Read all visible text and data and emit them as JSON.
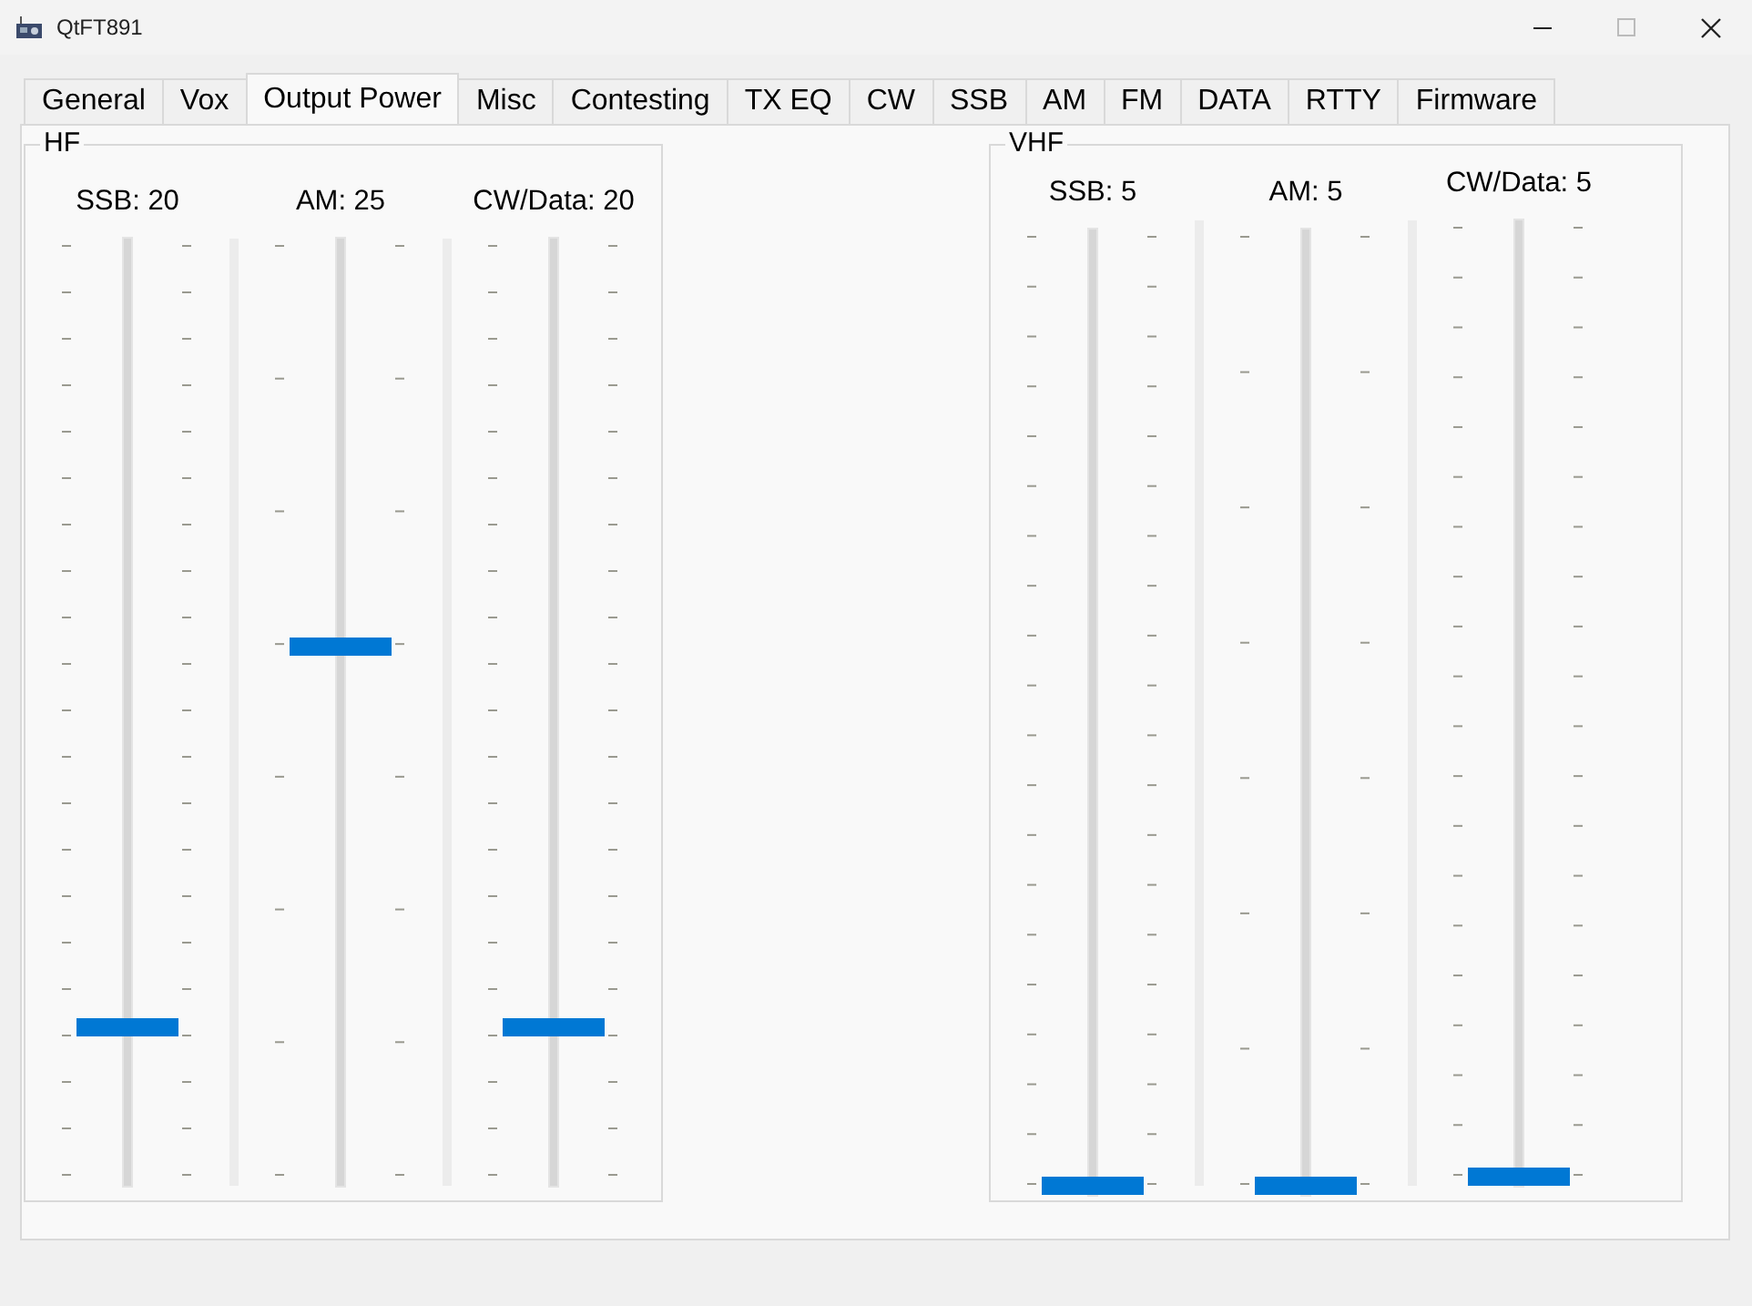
{
  "window": {
    "title": "QtFT891"
  },
  "tabs": [
    {
      "label": "General",
      "selected": false
    },
    {
      "label": "Vox",
      "selected": false
    },
    {
      "label": "Output Power",
      "selected": true
    },
    {
      "label": "Misc",
      "selected": false
    },
    {
      "label": "Contesting",
      "selected": false
    },
    {
      "label": "TX EQ",
      "selected": false
    },
    {
      "label": "CW",
      "selected": false
    },
    {
      "label": "SSB",
      "selected": false
    },
    {
      "label": "AM",
      "selected": false
    },
    {
      "label": "FM",
      "selected": false
    },
    {
      "label": "DATA",
      "selected": false
    },
    {
      "label": "RTTY",
      "selected": false
    },
    {
      "label": "Firmware",
      "selected": false
    }
  ],
  "groups": [
    {
      "title": "HF",
      "sliders": [
        {
          "label": "SSB: 20",
          "level": 0.16
        },
        {
          "label": "AM: 25",
          "level": 0.57
        },
        {
          "label": "CW/Data: 20",
          "level": 0.16
        }
      ]
    },
    {
      "title": "VHF",
      "sliders": [
        {
          "label": "SSB: 5",
          "level": 0
        },
        {
          "label": "AM: 5",
          "level": 0
        },
        {
          "label": "CW/Data: 5",
          "level": 0
        }
      ]
    }
  ]
}
